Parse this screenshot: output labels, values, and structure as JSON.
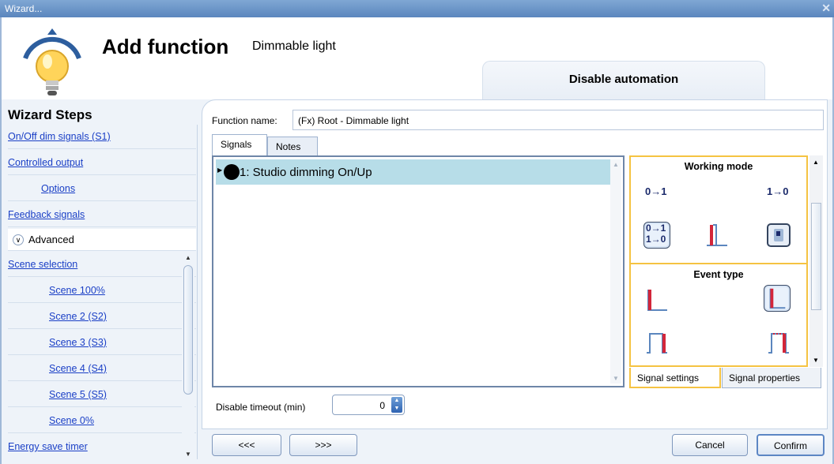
{
  "window": {
    "title": "Wizard...",
    "close_glyph": "✕"
  },
  "header": {
    "title": "Add function",
    "subtitle": "Dimmable light",
    "disable_automation_label": "Disable automation",
    "icon": "bulb-icon"
  },
  "wizard": {
    "title": "Wizard Steps",
    "steps": [
      {
        "label": "On/Off dim signals (S1)"
      },
      {
        "label": "Controlled output"
      },
      {
        "label": "Options"
      },
      {
        "label": "Feedback signals"
      }
    ],
    "advanced_label": "Advanced",
    "advanced_steps": [
      {
        "label": "Scene selection"
      },
      {
        "label": "Scene 100%"
      },
      {
        "label": "Scene 2 (S2)"
      },
      {
        "label": "Scene 3 (S3)"
      },
      {
        "label": "Scene 4 (S4)"
      },
      {
        "label": "Scene 5 (S5)"
      },
      {
        "label": "Scene 0%"
      },
      {
        "label": "Energy save timer"
      }
    ]
  },
  "function": {
    "name_label": "Function name:",
    "name_value": "(Fx) Root - Dimmable light"
  },
  "tabs": {
    "signals": "Signals",
    "notes": "Notes"
  },
  "signals": [
    {
      "label": "1: Studio dimming On/Up"
    }
  ],
  "properties": {
    "working_mode_title": "Working mode",
    "event_type_title": "Event type",
    "icon_0to1": "0→1",
    "icon_1to0": "1→0",
    "icon_both_a": "0→1",
    "icon_both_b": "1→0",
    "selected_working_mode": "0→1 / 1→0",
    "selected_event_type": "falling-edge-icon-b"
  },
  "property_tabs": {
    "settings": "Signal settings",
    "properties": "Signal properties"
  },
  "timeout": {
    "label": "Disable timeout (min)",
    "value": "0"
  },
  "buttons": {
    "prev": "<<<",
    "next": ">>>",
    "cancel": "Cancel",
    "confirm": "Confirm"
  },
  "colors": {
    "accent_yellow": "#f5c342",
    "selected_row": "#b7dde8",
    "link_blue": "#1a3fc6",
    "signal_red": "#d3263a"
  }
}
